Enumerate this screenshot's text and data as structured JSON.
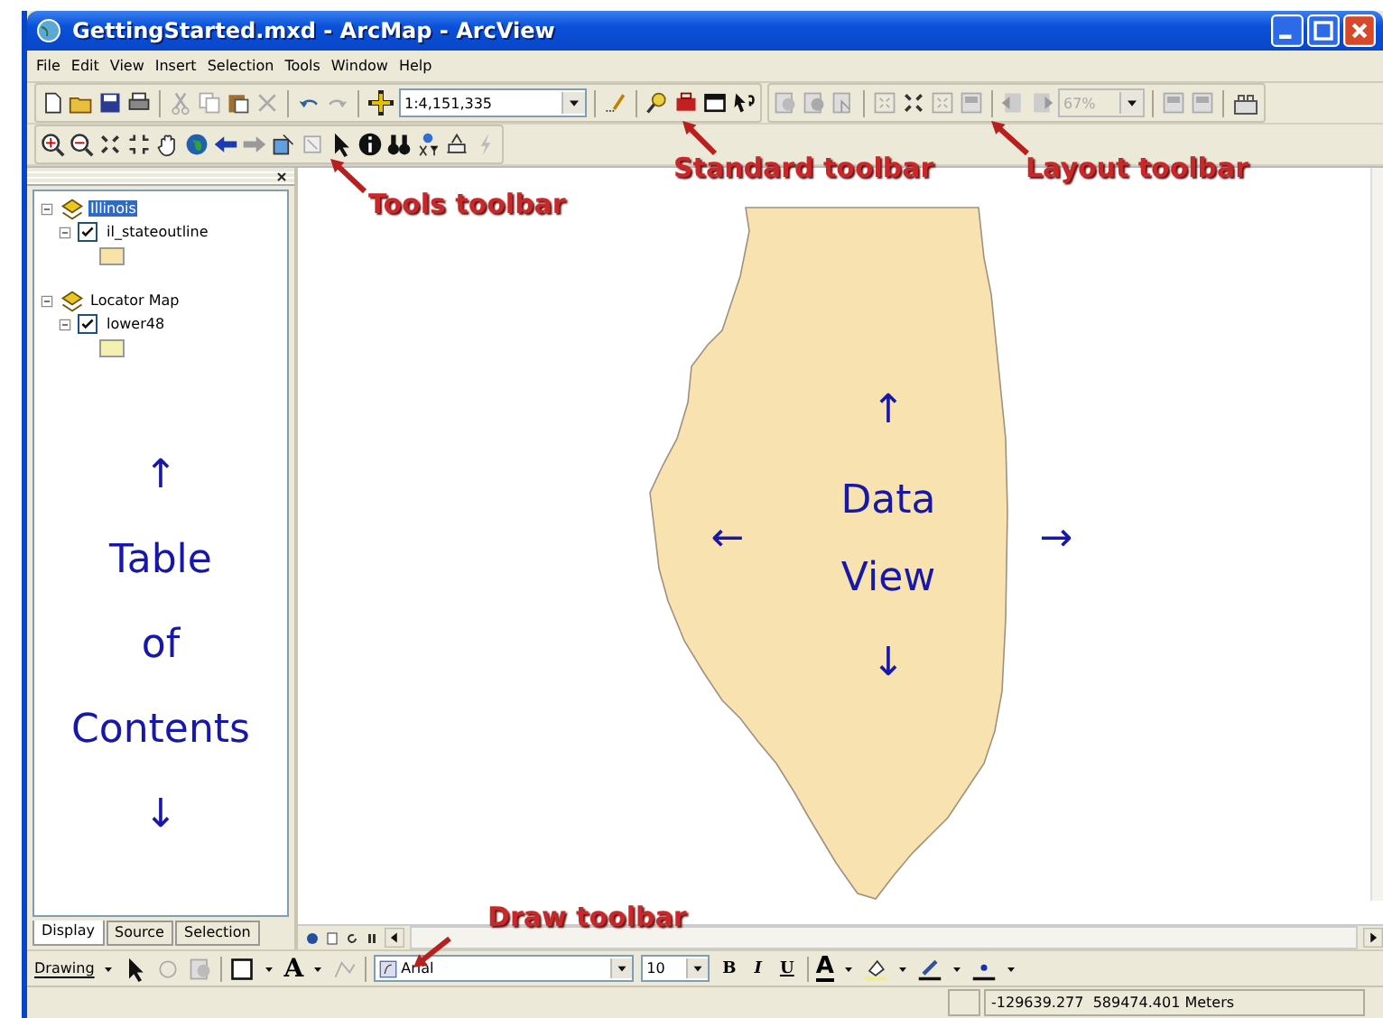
{
  "window": {
    "title": "GettingStarted.mxd - ArcMap - ArcView"
  },
  "menu": [
    "File",
    "Edit",
    "View",
    "Insert",
    "Selection",
    "Tools",
    "Window",
    "Help"
  ],
  "standard_toolbar": {
    "scale": "1:4,151,335"
  },
  "layout_toolbar": {
    "zoom": "67%"
  },
  "toc": {
    "items": [
      {
        "label": "Illinois",
        "kind": "frame",
        "selected": true,
        "expanded": true,
        "children": [
          {
            "label": "il_stateoutline",
            "kind": "layer",
            "checked": true,
            "expanded": true,
            "color": "#f8e2a8"
          }
        ]
      },
      {
        "label": "Locator Map",
        "kind": "frame",
        "selected": false,
        "expanded": true,
        "children": [
          {
            "label": "lower48",
            "kind": "layer",
            "checked": true,
            "expanded": true,
            "color": "#f4f0b0"
          }
        ]
      }
    ],
    "annotation": {
      "up": "↑",
      "lines": [
        "Table",
        "of",
        "Contents"
      ],
      "down": "↓"
    },
    "tabs": [
      {
        "label": "Display",
        "selected": true
      },
      {
        "label": "Source",
        "selected": false
      },
      {
        "label": "Selection",
        "selected": false
      }
    ]
  },
  "data_view": {
    "annotation": {
      "up": "↑",
      "left": "←",
      "lines": [
        "Data",
        "View"
      ],
      "right": "→",
      "down": "↓"
    }
  },
  "callouts": [
    {
      "text": "Tools toolbar"
    },
    {
      "text": "Standard toolbar"
    },
    {
      "text": "Layout toolbar"
    },
    {
      "text": "Draw toolbar"
    }
  ],
  "drawing_toolbar": {
    "menu": "Drawing",
    "text_tool": "A",
    "font": "Arial",
    "font_size": "10",
    "bold": "B",
    "italic": "I",
    "underline": "U",
    "font_color": "A"
  },
  "status_bar": {
    "coordinates": "-129639.277  589474.401 Meters"
  }
}
